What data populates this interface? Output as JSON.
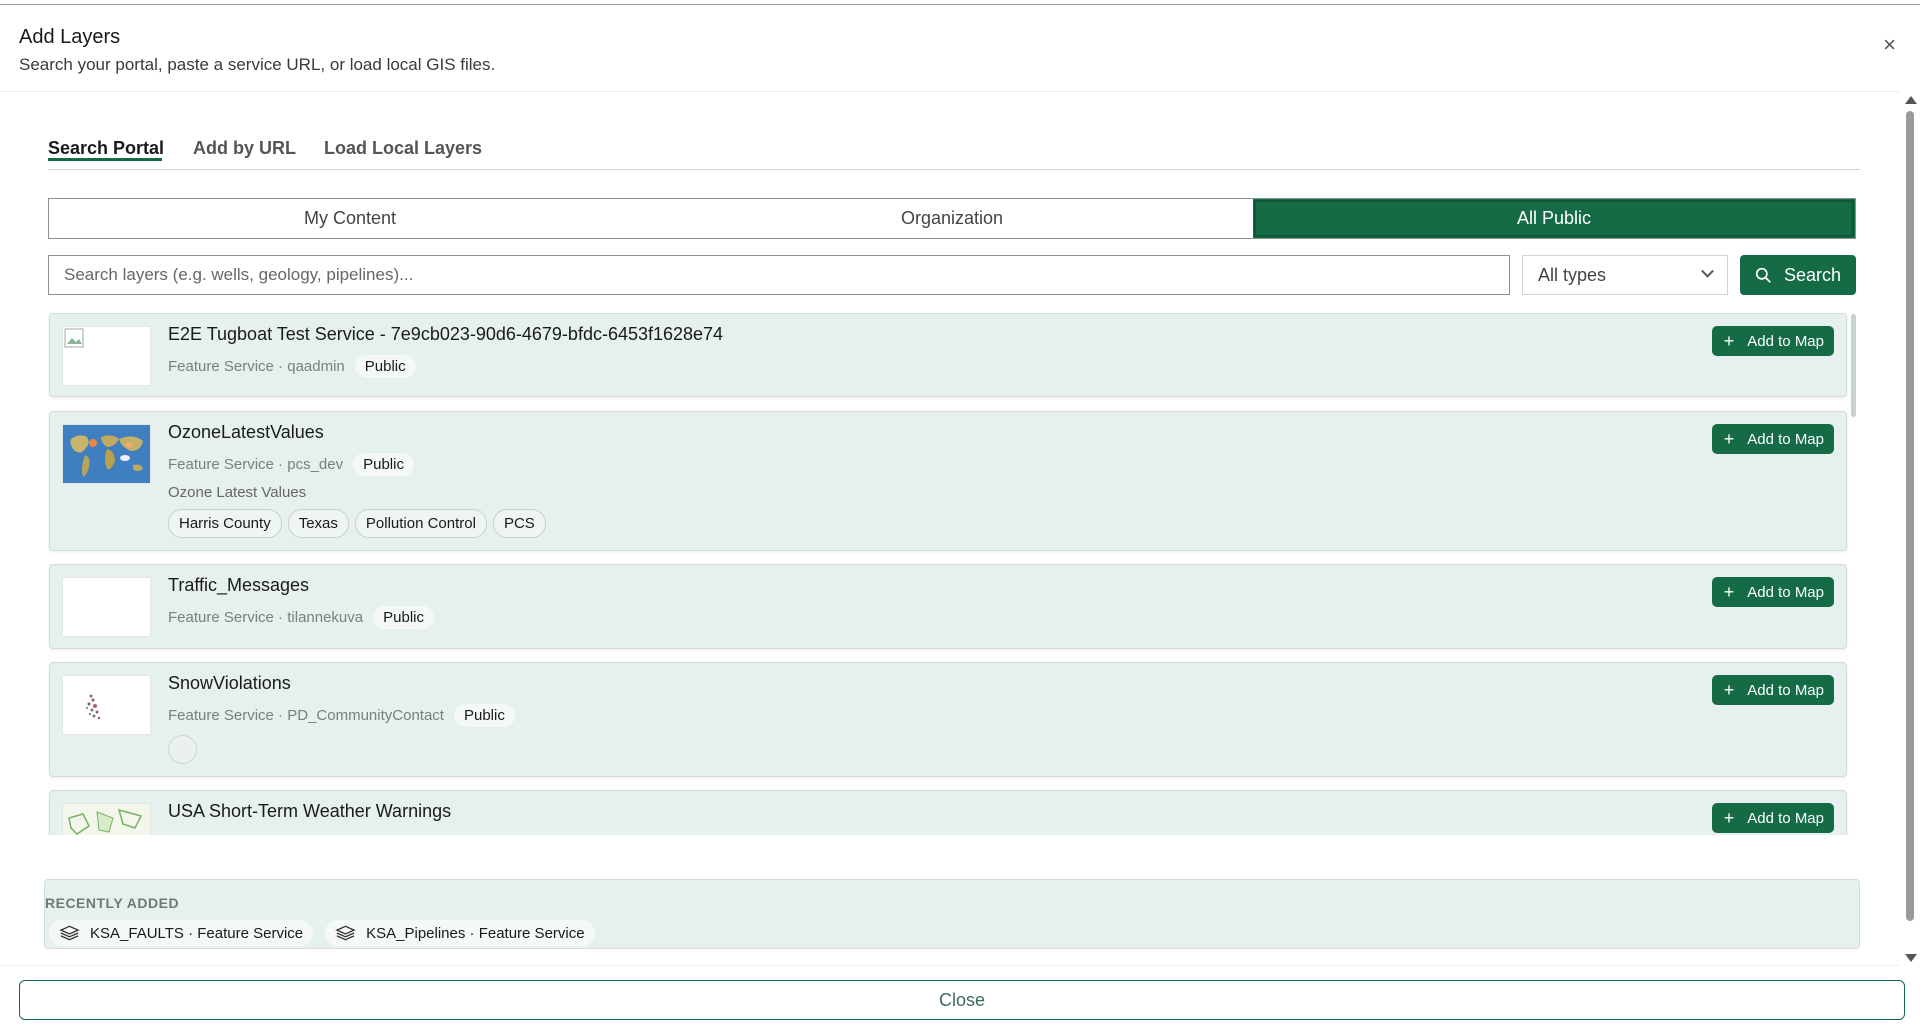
{
  "dialog": {
    "title": "Add Layers",
    "subtitle": "Search your portal, paste a service URL, or load local GIS files.",
    "close_icon": "close-icon"
  },
  "tabs": [
    {
      "label": "Search Portal",
      "active": true
    },
    {
      "label": "Add by URL",
      "active": false
    },
    {
      "label": "Load Local Layers",
      "active": false
    }
  ],
  "scope": [
    {
      "label": "My Content",
      "active": false
    },
    {
      "label": "Organization",
      "active": false
    },
    {
      "label": "All Public",
      "active": true
    }
  ],
  "search": {
    "placeholder": "Search layers (e.g. wells, geology, pipelines)...",
    "value": "",
    "type_filter": "All types",
    "button_label": "Search"
  },
  "results": [
    {
      "title": "E2E Tugboat Test Service - 7e9cb023-90d6-4679-bfdc-6453f1628e74",
      "type": "Feature Service",
      "owner": "qaadmin",
      "access": "Public",
      "thumbnail": "broken-image-icon",
      "button": "Add to Map"
    },
    {
      "title": "OzoneLatestValues",
      "type": "Feature Service",
      "owner": "pcs_dev",
      "access": "Public",
      "description": "Ozone Latest Values",
      "tags": [
        "Harris County",
        "Texas",
        "Pollution Control",
        "PCS"
      ],
      "thumbnail": "world-map-thumbnail",
      "button": "Add to Map"
    },
    {
      "title": "Traffic_Messages",
      "type": "Feature Service",
      "owner": "tilannekuva",
      "access": "Public",
      "thumbnail": "blank-thumbnail",
      "button": "Add to Map"
    },
    {
      "title": "SnowViolations",
      "type": "Feature Service",
      "owner": "PD_CommunityContact",
      "access": "Public",
      "thumbnail": "scatter-map-thumbnail",
      "button": "Add to Map"
    },
    {
      "title": "USA Short-Term Weather Warnings",
      "thumbnail": "warning-map-thumbnail",
      "button": "Add to Map"
    }
  ],
  "meta_separator": " · ",
  "recently_added": {
    "title": "RECENTLY ADDED",
    "items": [
      {
        "label": "KSA_FAULTS · Feature Service",
        "icon": "layers-icon"
      },
      {
        "label": "KSA_Pipelines · Feature Service",
        "icon": "layers-icon"
      }
    ]
  },
  "footer": {
    "close_label": "Close"
  },
  "colors": {
    "accent": "#146b46",
    "card_bg": "#e6f0ee"
  }
}
